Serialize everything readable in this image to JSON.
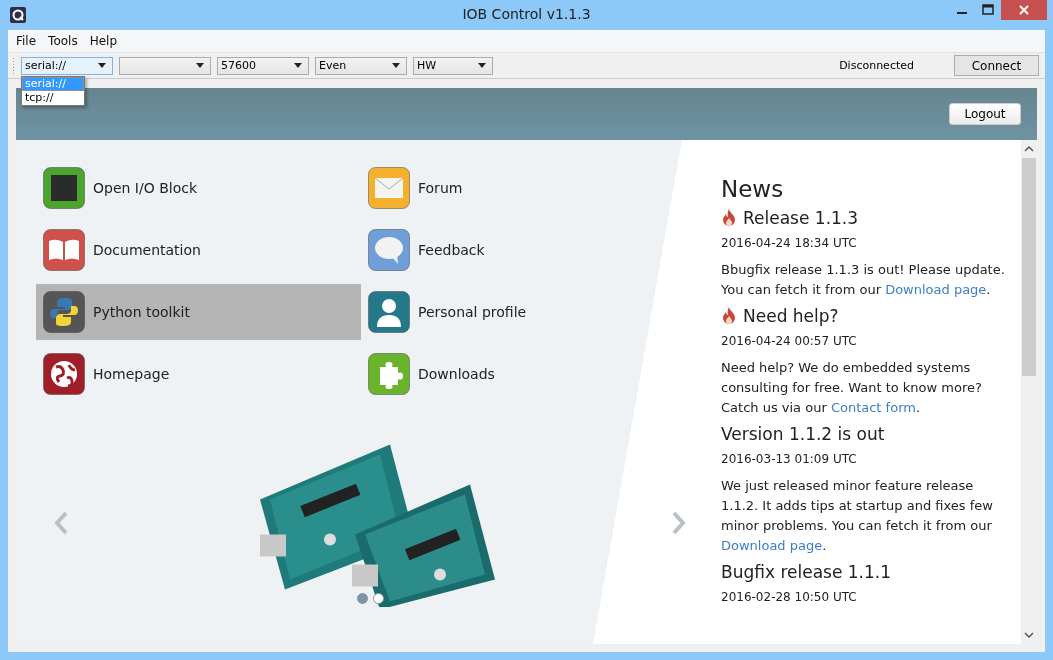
{
  "window": {
    "title": "IOB Control v1.1.3"
  },
  "menu": [
    "File",
    "Tools",
    "Help"
  ],
  "toolbar": {
    "combos": [
      {
        "value": "serial://",
        "expanded": true,
        "options": [
          {
            "label": "serial://",
            "selected": true
          },
          {
            "label": "tcp://",
            "selected": false
          }
        ]
      },
      {
        "expanded": false
      },
      {
        "value": "57600",
        "expanded": false
      },
      {
        "value": "Even",
        "expanded": false
      },
      {
        "value": "HW",
        "expanded": false
      }
    ],
    "status": "Disconnected",
    "connect_button": "Connect"
  },
  "header": {
    "logout_button": "Logout"
  },
  "launcher": [
    {
      "label": "Open I/O Block",
      "selected": false
    },
    {
      "label": "Forum",
      "selected": false
    },
    {
      "label": "Documentation",
      "selected": false
    },
    {
      "label": "Feedback",
      "selected": false
    },
    {
      "label": "Python toolkit",
      "selected": true
    },
    {
      "label": "Personal profile",
      "selected": false
    },
    {
      "label": "Homepage",
      "selected": false
    },
    {
      "label": "Downloads",
      "selected": false
    }
  ],
  "carousel": {
    "dots": [
      {
        "selected": true
      },
      {
        "selected": false
      }
    ]
  },
  "news": {
    "title": "News",
    "items": [
      {
        "title": "Release 1.1.3",
        "hot": true,
        "date": "2016-04-24 18:34 UTC",
        "body": [
          {
            "text": "Bbugfix release 1.1.3 is out! Please update. You can fetch it from our "
          },
          {
            "link": "Download page"
          },
          {
            "text": "."
          }
        ]
      },
      {
        "title": "Need help?",
        "hot": true,
        "date": "2016-04-24 00:57 UTC",
        "body": [
          {
            "text": "Need help? We do embedded systems consulting for free. Want to know more? Catch us via our "
          },
          {
            "link": "Contact form"
          },
          {
            "text": "."
          }
        ]
      },
      {
        "title": "Version 1.1.2 is out",
        "hot": false,
        "date": "2016-03-13 01:09 UTC",
        "body": [
          {
            "text": "We just released minor feature release 1.1.2. It adds tips at startup and fixes few minor problems. You can fetch it from our "
          },
          {
            "link": "Download page"
          },
          {
            "text": "."
          }
        ]
      },
      {
        "title": "Bugfix release 1.1.1",
        "hot": false,
        "date": "2016-02-28 10:50 UTC"
      }
    ]
  }
}
